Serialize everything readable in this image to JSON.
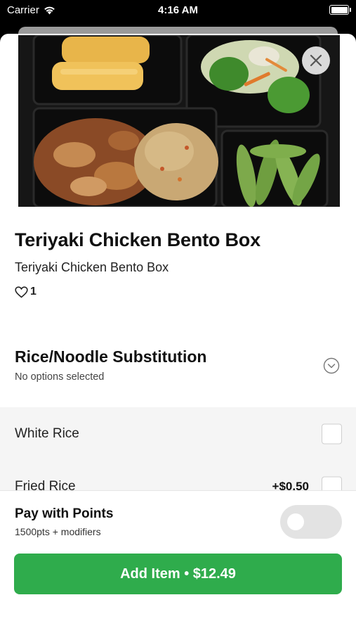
{
  "status_bar": {
    "carrier": "Carrier",
    "time": "4:16 AM"
  },
  "item": {
    "title": "Teriyaki Chicken Bento Box",
    "description": "Teriyaki Chicken Bento Box",
    "likes": "1",
    "image_alt_icon": "close-icon"
  },
  "modifier_group": {
    "title": "Rice/Noodle Substitution",
    "status": "No options selected",
    "options": [
      {
        "label": "White Rice",
        "price": ""
      },
      {
        "label": "Fried Rice",
        "price": "+$0.50"
      }
    ]
  },
  "points": {
    "title": "Pay with Points",
    "subtitle": "1500pts + modifiers",
    "enabled": false
  },
  "cta": {
    "label": "Add Item • $12.49"
  },
  "colors": {
    "accent": "#2fac4c",
    "toggle_off": "#e3e3e3"
  }
}
